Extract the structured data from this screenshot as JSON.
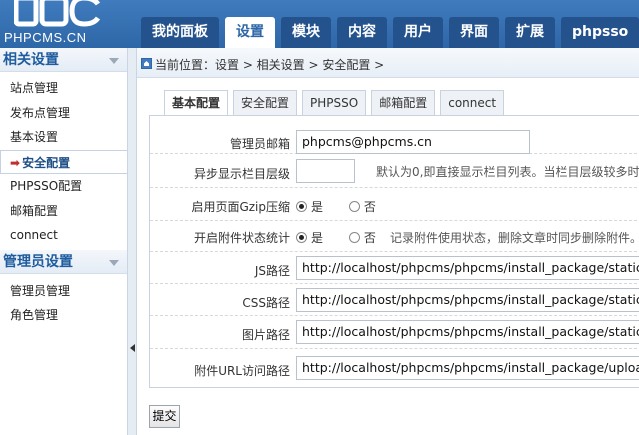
{
  "header": {
    "logo_text": "PHPCMS.CN",
    "nav": [
      {
        "label": "我的面板"
      },
      {
        "label": "设置"
      },
      {
        "label": "模块"
      },
      {
        "label": "内容"
      },
      {
        "label": "用户"
      },
      {
        "label": "界面"
      },
      {
        "label": "扩展"
      },
      {
        "label": "phpsso"
      }
    ],
    "active_nav": "设置"
  },
  "sidebar": {
    "sections": [
      {
        "title": "相关设置",
        "items": [
          "站点管理",
          "发布点管理",
          "基本设置",
          "安全配置",
          "PHPSSO配置",
          "邮箱配置",
          "connect"
        ]
      },
      {
        "title": "管理员设置",
        "items": [
          "管理员管理",
          "角色管理"
        ]
      }
    ],
    "active_item": "安全配置",
    "active_marker": "➡"
  },
  "breadcrumb": {
    "text": "当前位置：设置 > 相关设置 > 安全配置 >"
  },
  "config_tabs": [
    "基本配置",
    "安全配置",
    "PHPSSO",
    "邮箱配置",
    "connect"
  ],
  "active_config_tab": "基本配置",
  "form": {
    "admin_email": {
      "label": "管理员邮箱",
      "value": "phpcms@phpcms.cn"
    },
    "async_category": {
      "label": "异步显示栏目层级",
      "value": "",
      "hint": "默认为0,即直接显示栏目列表。当栏目层级较多时"
    },
    "gzip": {
      "label": "启用页面Gzip压缩",
      "yes": "是",
      "no": "否",
      "selected": "是"
    },
    "attachment_stat": {
      "label": "开启附件状态统计",
      "yes": "是",
      "no": "否",
      "selected": "是",
      "hint": "记录附件使用状态，删除文章时同步删除附件。"
    },
    "js_path": {
      "label": "JS路径",
      "value": "http://localhost/phpcms/phpcms/install_package/statics/js/"
    },
    "css_path": {
      "label": "CSS路径",
      "value": "http://localhost/phpcms/phpcms/install_package/statics/css/"
    },
    "img_path": {
      "label": "图片路径",
      "value": "http://localhost/phpcms/phpcms/install_package/statics/images/"
    },
    "upload_url": {
      "label": "附件URL访问路径",
      "value": "http://localhost/phpcms/phpcms/install_package/uploadfile/"
    }
  },
  "submit_label": "提交",
  "colors": {
    "header_blue": "#2e67a8",
    "tab_dark": "#24528c",
    "accent_red": "#c03030"
  }
}
